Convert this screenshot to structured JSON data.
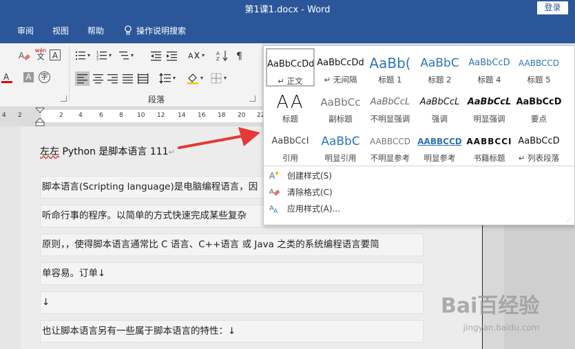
{
  "window": {
    "title": "第1课1.docx  -  Word",
    "login_label": "登录"
  },
  "ribbon_tabs": [
    {
      "label": "审阅"
    },
    {
      "label": "视图"
    },
    {
      "label": "帮助"
    },
    {
      "label": "操作说明搜索"
    }
  ],
  "ribbon": {
    "group_label": "段落",
    "font_marks": {
      "phonetic_top": "wén",
      "phonetic_glyph": "文",
      "boxed": "A",
      "circled": "字"
    }
  },
  "ruler": {
    "numbers": [
      "4",
      "2",
      "2",
      "4",
      "6",
      "8",
      "10",
      "12",
      "14",
      "16",
      "18",
      "20",
      "22"
    ]
  },
  "document": {
    "heading_squiggle": "左左",
    "heading_rest": " Python 是脚本语言 111",
    "paragraphs": [
      "脚本语言(Scripting language)是电脑编程语言，因",
      "听命行事的程序。以简单的方式快速完成某些复杂",
      "原则，，使得脚本语言通常比 C 语言、C++语言 或 Java 之类的系统编程语言要简",
      "单容易。订单↓",
      "↓",
      "也让脚本语言另有一些属于脚本语言的特性：↓"
    ],
    "return_mark": "↵"
  },
  "styles_gallery": {
    "rows": [
      [
        {
          "sample": "AaBbCcDd",
          "name": "↵ 正文",
          "selected": true
        },
        {
          "sample": "AaBbCcDd",
          "name": "↵ 无间隔"
        },
        {
          "sample": "AaBb(",
          "name": "标题 1"
        },
        {
          "sample": "AaBbC",
          "name": "标题 2"
        },
        {
          "sample": "AaBbCcD",
          "name": "标题 4"
        },
        {
          "sample": "AABBCCD",
          "name": "标题 5"
        }
      ],
      [
        {
          "sample": "AA",
          "name": "标题"
        },
        {
          "sample": "AaBbCc",
          "name": "副标题"
        },
        {
          "sample": "AaBbCcL",
          "name": "不明显强调"
        },
        {
          "sample": "AaBbCcL",
          "name": "强调"
        },
        {
          "sample": "AaBbCcL",
          "name": "明显强调"
        },
        {
          "sample": "AaBbCcD",
          "name": "要点"
        }
      ],
      [
        {
          "sample": "AaBbCcI",
          "name": "引用"
        },
        {
          "sample": "AaBbC",
          "name": "明显引用"
        },
        {
          "sample": "AABBCCD",
          "name": "不明显参考"
        },
        {
          "sample": "AABBCCD",
          "name": "明显参考"
        },
        {
          "sample": "AABBCCI",
          "name": "书籍标题"
        },
        {
          "sample": "AaBbCcD",
          "name": "↵ 列表段落"
        }
      ]
    ],
    "menu": [
      {
        "label": "创建样式(S)"
      },
      {
        "label": "清除格式(C)"
      },
      {
        "label": "应用样式(A)..."
      }
    ]
  },
  "watermark": {
    "brand": "Bai百经验",
    "url": "jingyan.baidu.com"
  },
  "colors": {
    "word_blue": "#2b579a",
    "arrow_red": "#e53935",
    "heading_blue": "#2e74b5"
  }
}
